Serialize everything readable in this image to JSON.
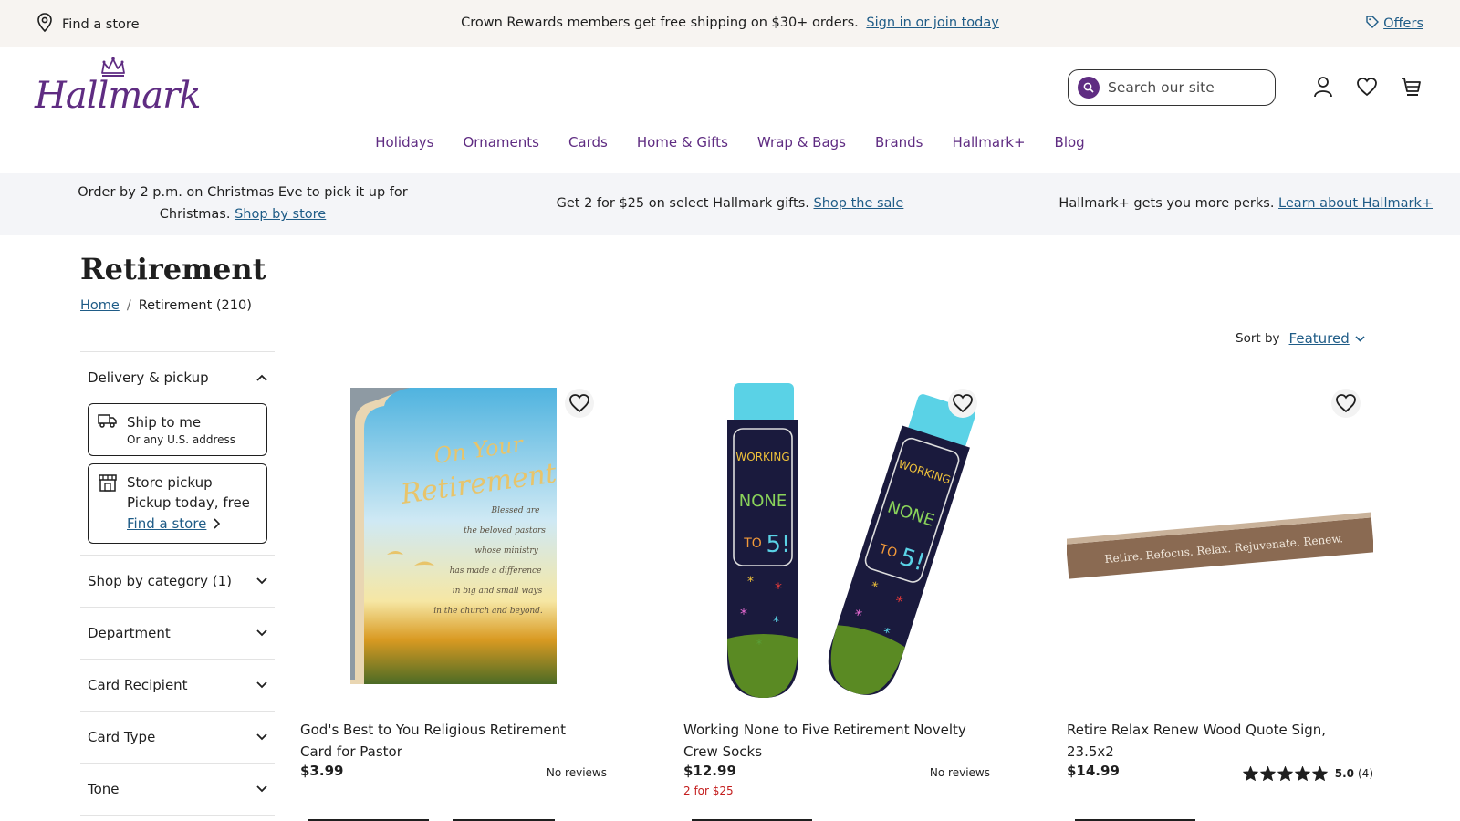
{
  "utility_bar": {
    "find_store": "Find a store",
    "promo_text": "Crown Rewards members get free shipping on $30+ orders.",
    "promo_link": "Sign in or join today",
    "offers": "Offers"
  },
  "header": {
    "logo": "Hallmark",
    "search_placeholder": "Search our site",
    "nav": [
      "Holidays",
      "Ornaments",
      "Cards",
      "Home & Gifts",
      "Wrap & Bags",
      "Brands",
      "Hallmark+",
      "Blog"
    ],
    "brand_color": "#5f2c82",
    "link_color": "#1f5c87"
  },
  "promo_strip": [
    {
      "text": "Order by 2 p.m. on Christmas Eve to pick it up for Christmas.",
      "link": "Shop by store"
    },
    {
      "text": "Get 2 for $25 on select Hallmark gifts.",
      "link": "Shop the sale"
    },
    {
      "text": "Hallmark+ gets you more perks.",
      "link": "Learn about Hallmark+"
    }
  ],
  "page": {
    "title": "Retirement",
    "breadcrumb_home": "Home",
    "breadcrumb_current": "Retirement (210)",
    "sort_label": "Sort by",
    "sort_value": "Featured"
  },
  "filters": {
    "delivery": {
      "label": "Delivery & pickup",
      "ship_title": "Ship to me",
      "ship_sub": "Or any U.S. address",
      "pickup_title": "Store pickup",
      "pickup_sub": "Pickup today, free",
      "pickup_link": "Find a store"
    },
    "groups": [
      "Shop by category (1)",
      "Department",
      "Card Recipient",
      "Card Type",
      "Tone"
    ]
  },
  "products": [
    {
      "name": "God's Best to You Religious Retirement Card for Pastor",
      "price": "$3.99",
      "reviews": "No reviews",
      "deal": "",
      "card_text": [
        "On Your",
        "Retirement",
        "Blessed are",
        "the beloved pastors",
        "whose ministry",
        "has made a difference",
        "in big and small ways",
        "in the church and beyond."
      ]
    },
    {
      "name": "Working None to Five Retirement Novelty Crew Socks",
      "price": "$12.99",
      "reviews": "No reviews",
      "deal": "2 for $25",
      "sock_text": [
        "WORKING",
        "NONE",
        "TO",
        "5!"
      ]
    },
    {
      "name": "Retire Relax Renew Wood Quote Sign, 23.5x2",
      "price": "$14.99",
      "rating": "5.0",
      "review_count": "(4)",
      "stars": 5,
      "deal": "",
      "sign_text": "Retire. Refocus. Relax. Rejuvenate. Renew."
    }
  ]
}
